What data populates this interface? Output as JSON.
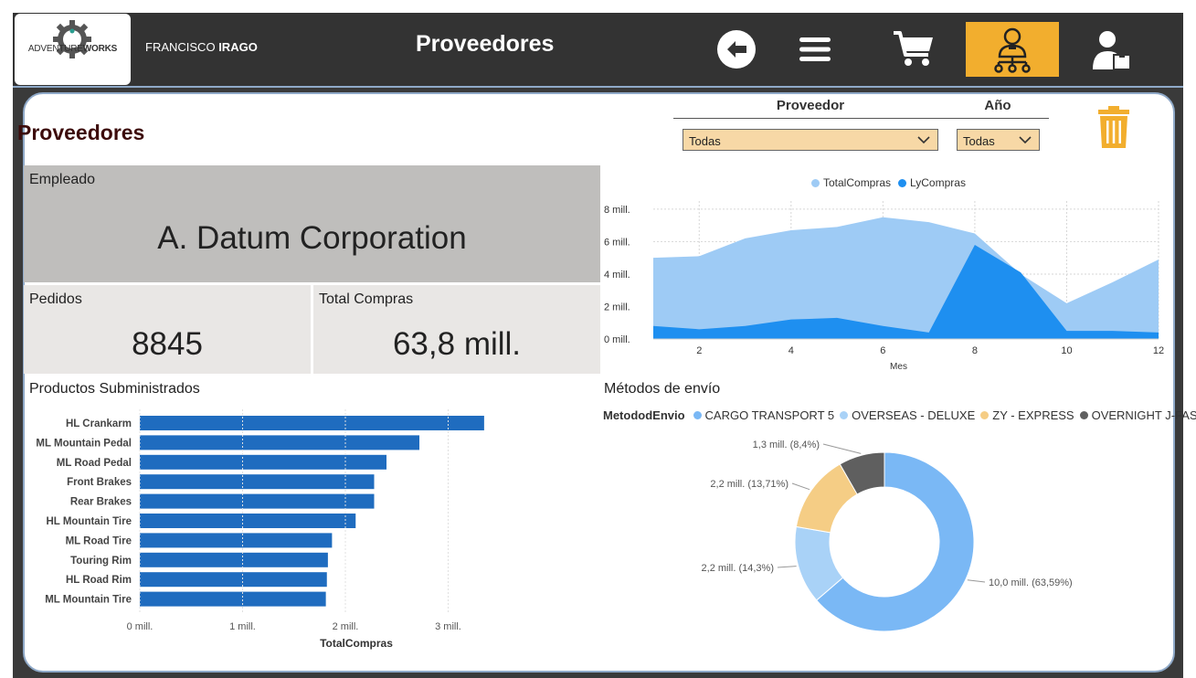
{
  "header": {
    "logo_prefix": "ADVENTURE",
    "logo_suffix": "WORKS",
    "user_first": "FRANCISCO",
    "user_last": "IRAGO",
    "page_title": "Proveedores",
    "nav": [
      {
        "name": "back-icon",
        "active": false
      },
      {
        "name": "menu-icon",
        "active": false
      },
      {
        "name": "cart-icon",
        "active": false
      },
      {
        "name": "supplier-network-icon",
        "active": true
      },
      {
        "name": "employee-icon",
        "active": false
      }
    ],
    "accent_color": "#f2ae2e"
  },
  "report": {
    "title": "Proveedores",
    "filters": {
      "proveedor_label": "Proveedor",
      "proveedor_value": "Todas",
      "anio_label": "Año",
      "anio_value": "Todas"
    },
    "cards": {
      "empleado_label": "Empleado",
      "empleado_value": "A. Datum Corporation",
      "pedidos_label": "Pedidos",
      "pedidos_value": "8845",
      "total_label": "Total Compras",
      "total_value": "63,8 mill."
    },
    "products_title": "Productos Subministrados",
    "shipping_title": "Métodos de envío",
    "shipping_legend_title": "MetododEnvio"
  },
  "chart_data": [
    {
      "type": "area",
      "title": "",
      "xlabel": "Mes",
      "ylabel": "",
      "x": [
        1,
        2,
        3,
        4,
        5,
        6,
        7,
        8,
        9,
        10,
        11,
        12
      ],
      "x_ticks": [
        "2",
        "4",
        "6",
        "8",
        "10",
        "12"
      ],
      "y_ticks": [
        "0 mill.",
        "2 mill.",
        "4 mill.",
        "6 mill.",
        "8 mill."
      ],
      "ylim": [
        0,
        8.5
      ],
      "grid": true,
      "legend": "top-center",
      "series": [
        {
          "name": "TotalCompras",
          "color": "#9ecbf5",
          "values": [
            5.0,
            5.1,
            6.2,
            6.7,
            6.9,
            7.5,
            7.2,
            6.5,
            4.0,
            2.2,
            3.5,
            4.9
          ]
        },
        {
          "name": "LyCompras",
          "color": "#1e8ff0",
          "values": [
            0.8,
            0.6,
            0.8,
            1.2,
            1.3,
            0.8,
            0.4,
            5.8,
            4.1,
            0.5,
            0.5,
            0.4
          ]
        }
      ]
    },
    {
      "type": "bar",
      "orientation": "horizontal",
      "title": "Productos Subministrados",
      "xlabel": "TotalCompras",
      "ylabel": "",
      "categories": [
        "HL Crankarm",
        "ML Mountain Pedal",
        "ML Road Pedal",
        "Front Brakes",
        "Rear Brakes",
        "HL Mountain Tire",
        "ML Road Tire",
        "Touring Rim",
        "HL Road Rim",
        "ML Mountain Tire"
      ],
      "values": [
        3.35,
        2.72,
        2.4,
        2.28,
        2.28,
        2.1,
        1.87,
        1.83,
        1.82,
        1.81
      ],
      "x_ticks": [
        "0 mill.",
        "1 mill.",
        "2 mill.",
        "3 mill."
      ],
      "xlim": [
        0,
        3.6
      ],
      "color": "#1f6cbf"
    },
    {
      "type": "pie",
      "donut": true,
      "title": "Métodos de envío",
      "legend_title": "MetododEnvio",
      "legend": "top",
      "slices": [
        {
          "name": "CARGO TRANSPORT 5",
          "value": 10.0,
          "label": "10,0 mill. (63,59%)",
          "color": "#7ab8f5"
        },
        {
          "name": "OVERSEAS - DELUXE",
          "value": 2.2,
          "label": "2,2 mill. (14,3%)",
          "color": "#a9d2f7"
        },
        {
          "name": "ZY - EXPRESS",
          "value": 2.2,
          "label": "2,2 mill. (13,71%)",
          "color": "#f5cd85"
        },
        {
          "name": "OVERNIGHT J-FAST",
          "value": 1.3,
          "label": "1,3 mill. (8,4%)",
          "color": "#5f5f5f"
        }
      ]
    }
  ]
}
